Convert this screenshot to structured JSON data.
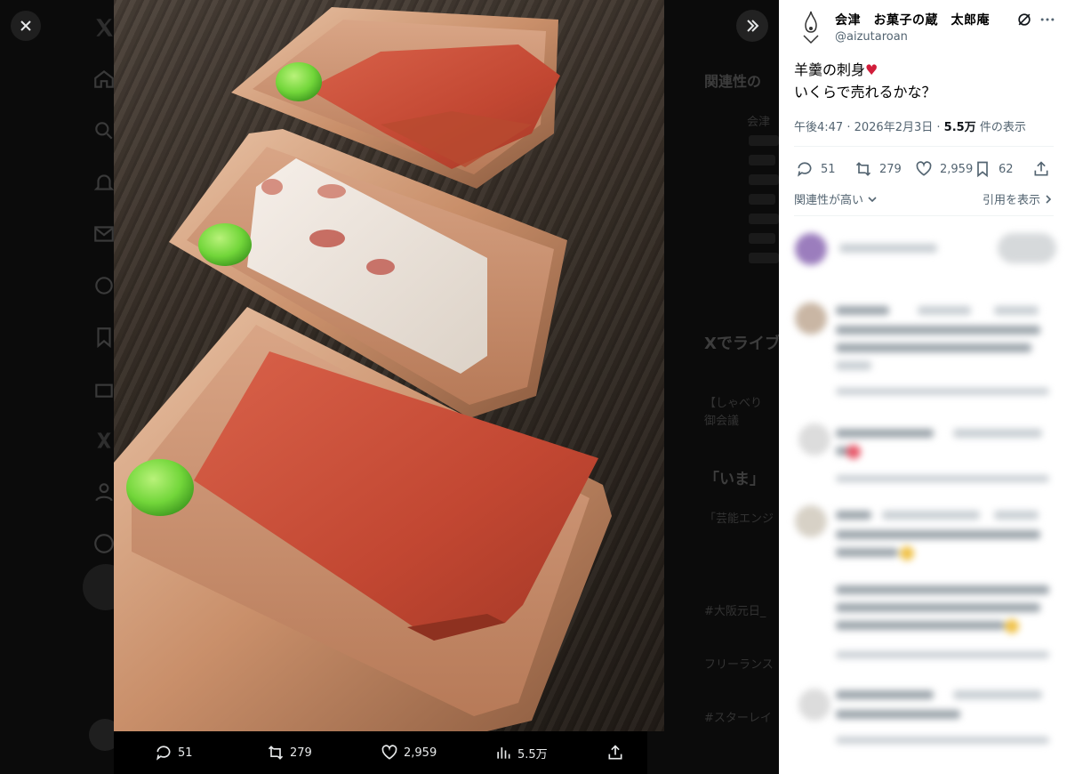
{
  "modal": {
    "close_label": "×",
    "expand_label": "»"
  },
  "media_bar": {
    "replies": "51",
    "reposts": "279",
    "likes": "2,959",
    "views": "5.5万"
  },
  "post": {
    "author_name": "会津　お菓子の蔵　太郎庵",
    "author_handle": "@aizutaroan",
    "text_line1": "羊羹の刺身",
    "text_heart": "♥",
    "text_line2": "いくらで売れるかな？",
    "time": "午後4:47",
    "date": "2026年2月3日",
    "views_count": "5.5万",
    "views_label": "件の表示",
    "replies": "51",
    "reposts": "279",
    "likes": "2,959",
    "bookmarks": "62",
    "sort_label": "関連性が高い",
    "quotes_label": "引用を表示"
  },
  "background": {
    "related_title": "関連性の",
    "related_user": "会津",
    "live_title": "Xでライブ",
    "live_sub": "【しゃべり",
    "live_sub2": "御会議",
    "trend1": "「いま」",
    "trend2": "「芸能エンジ",
    "trend3": "#大阪元日_",
    "trend4": "フリーランス",
    "trend5": "#スターレイ"
  },
  "colors": {
    "accent_heart": "#d11d3a",
    "text_primary": "#0f1419",
    "text_secondary": "#536471"
  },
  "icons": [
    "close-icon",
    "expand-icon",
    "reply-icon",
    "repost-icon",
    "like-icon",
    "views-icon",
    "share-icon",
    "bookmark-icon",
    "grok-icon",
    "more-icon",
    "chevron-down-icon",
    "chevron-right-icon"
  ]
}
